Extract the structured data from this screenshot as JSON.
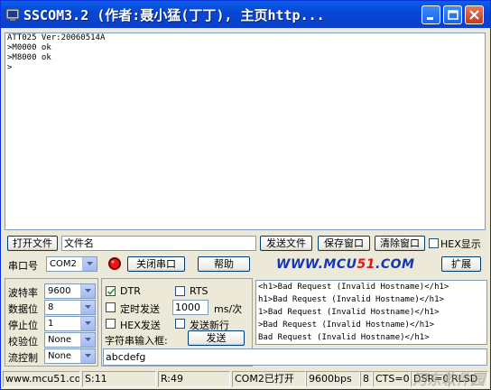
{
  "window": {
    "title": "SSCOM3.2 (作者:聂小猛(丁丁), 主页http..."
  },
  "receive": {
    "lines": [
      "ATT025 Ver:20060514A",
      ">M0000 ok",
      ">M8000 ok",
      ">"
    ]
  },
  "file_row": {
    "open_file": "打开文件",
    "file_name": "文件名",
    "send_file": "发送文件",
    "save_window": "保存窗口",
    "clear_window": "清除窗口",
    "hex_display": "HEX显示"
  },
  "port_row": {
    "port_label": "串口号",
    "port_value": "COM2",
    "close_port": "关闭串口",
    "help": "帮助",
    "url_prefix": "WWW.MCU",
    "url_num": "51",
    "url_suffix": ".COM",
    "expand": "扩展"
  },
  "settings": {
    "baud_label": "波特率",
    "baud_value": "9600",
    "databits_label": "数据位",
    "databits_value": "8",
    "stopbits_label": "停止位",
    "stopbits_value": "1",
    "parity_label": "校验位",
    "parity_value": "None",
    "flow_label": "流控制",
    "flow_value": "None"
  },
  "options": {
    "dtr": "DTR",
    "rts": "RTS",
    "timed_send": "定时发送",
    "interval": "1000",
    "interval_unit": "ms/次",
    "hex_send": "HEX发送",
    "send_newline": "发送新行",
    "input_label": "字符串输入框:",
    "send": "发送",
    "input_value": "abcdefg"
  },
  "response": {
    "lines": [
      "<h1>Bad Request (Invalid Hostname)</h1>",
      "h1>Bad Request (Invalid Hostname)</h1>",
      "1>Bad Request (Invalid Hostname)</h1>",
      ">Bad Request (Invalid Hostname)</h1>",
      "Bad Request (Invalid Hostname)</h1>"
    ]
  },
  "status": {
    "site": "www.mcu51.cor",
    "sent": "S:11",
    "received": "R:49",
    "port_status": "COM2已打开",
    "baud": "9600bps",
    "lines": "8",
    "cts": "CTS=0",
    "dsr": "DSR=0",
    "rlsd": "RLSD"
  },
  "watermark": "河东软件园"
}
